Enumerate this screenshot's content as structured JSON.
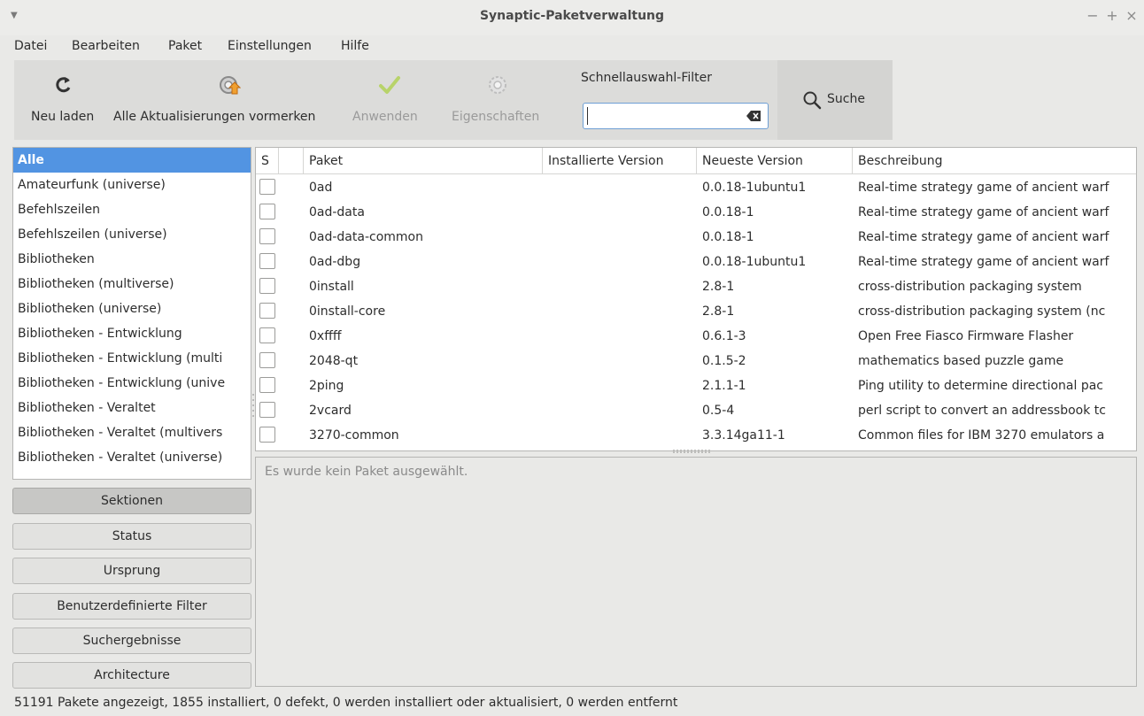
{
  "window": {
    "title": "Synaptic-Paketverwaltung",
    "controls": [
      "−",
      "+",
      "×"
    ]
  },
  "menu": [
    "Datei",
    "Bearbeiten",
    "Paket",
    "Einstellungen",
    "Hilfe"
  ],
  "toolbar": {
    "reload": "Neu laden",
    "mark_all": "Alle Aktualisierungen vormerken",
    "apply": "Anwenden",
    "properties": "Eigenschaften",
    "filter_label": "Schnellauswahl-Filter",
    "filter_value": "",
    "search": "Suche"
  },
  "sections": {
    "items": [
      "Alle",
      "Amateurfunk (universe)",
      "Befehlszeilen",
      "Befehlszeilen (universe)",
      "Bibliotheken",
      "Bibliotheken (multiverse)",
      "Bibliotheken (universe)",
      "Bibliotheken - Entwicklung",
      "Bibliotheken - Entwicklung (multi",
      "Bibliotheken - Entwicklung (unive",
      "Bibliotheken - Veraltet",
      "Bibliotheken - Veraltet (multivers",
      "Bibliotheken - Veraltet (universe)"
    ],
    "selected": "Alle"
  },
  "filter_buttons": [
    "Sektionen",
    "Status",
    "Ursprung",
    "Benutzerdefinierte Filter",
    "Suchergebnisse",
    "Architecture"
  ],
  "active_filter": "Sektionen",
  "table": {
    "headers": [
      "S",
      "",
      "Paket",
      "Installierte Version",
      "Neueste Version",
      "Beschreibung"
    ],
    "rows": [
      {
        "name": "0ad",
        "installed": "",
        "latest": "0.0.18-1ubuntu1",
        "desc": "Real-time strategy game of ancient warf"
      },
      {
        "name": "0ad-data",
        "installed": "",
        "latest": "0.0.18-1",
        "desc": "Real-time strategy game of ancient warf"
      },
      {
        "name": "0ad-data-common",
        "installed": "",
        "latest": "0.0.18-1",
        "desc": "Real-time strategy game of ancient warf"
      },
      {
        "name": "0ad-dbg",
        "installed": "",
        "latest": "0.0.18-1ubuntu1",
        "desc": "Real-time strategy game of ancient warf"
      },
      {
        "name": "0install",
        "installed": "",
        "latest": "2.8-1",
        "desc": "cross-distribution packaging system"
      },
      {
        "name": "0install-core",
        "installed": "",
        "latest": "2.8-1",
        "desc": "cross-distribution packaging system (nc"
      },
      {
        "name": "0xffff",
        "installed": "",
        "latest": "0.6.1-3",
        "desc": "Open Free Fiasco Firmware Flasher"
      },
      {
        "name": "2048-qt",
        "installed": "",
        "latest": "0.1.5-2",
        "desc": "mathematics based puzzle game"
      },
      {
        "name": "2ping",
        "installed": "",
        "latest": "2.1.1-1",
        "desc": "Ping utility to determine directional pac"
      },
      {
        "name": "2vcard",
        "installed": "",
        "latest": "0.5-4",
        "desc": "perl script to convert an addressbook tc"
      },
      {
        "name": "3270-common",
        "installed": "",
        "latest": "3.3.14ga11-1",
        "desc": "Common files for IBM 3270 emulators a"
      }
    ]
  },
  "description_pane": {
    "text": "Es wurde kein Paket ausgewählt."
  },
  "status": "51191 Pakete angezeigt, 1855 installiert, 0 defekt, 0 werden installiert oder aktualisiert, 0 werden entfernt"
}
